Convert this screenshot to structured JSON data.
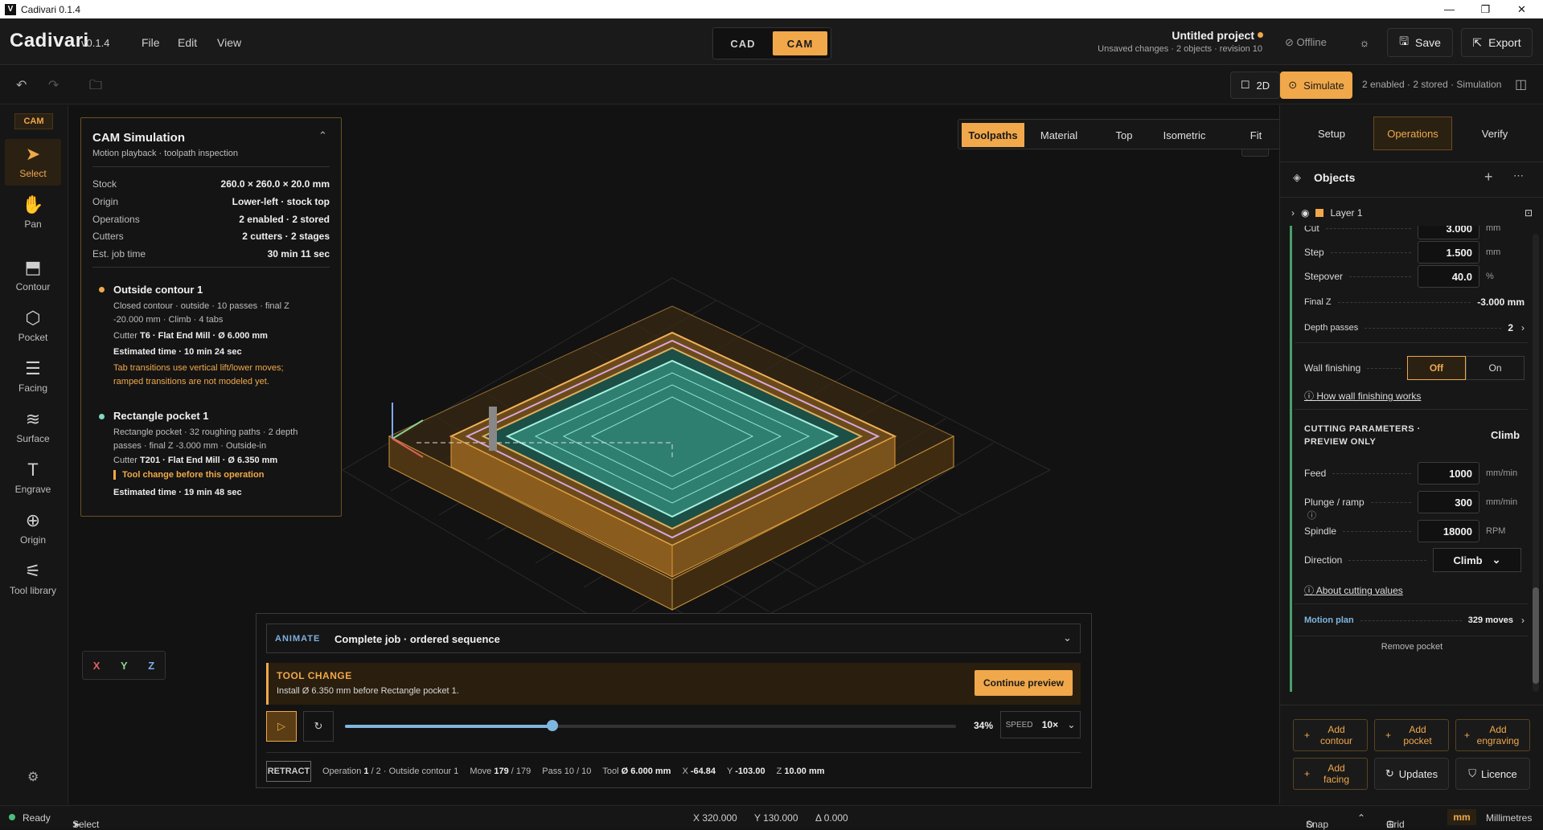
{
  "window": {
    "title": "Cadivari 0.1.4",
    "icon": "V"
  },
  "header": {
    "brand": "Cadivari",
    "version": "v0.1.4",
    "menu": [
      "File",
      "Edit",
      "View"
    ],
    "mode_cad": "CAD",
    "mode_cam": "CAM",
    "project_title": "Untitled project",
    "project_sub": "Unsaved changes · 2 objects · revision 10",
    "offline": "Offline",
    "save": "Save",
    "export": "Export"
  },
  "toolbar": {
    "toggle_2d": "2D",
    "simulate": "Simulate",
    "status": "2 enabled · 2 stored · Simulation"
  },
  "left_tools": {
    "badge": "CAM",
    "items": [
      "Select",
      "Pan",
      "Contour",
      "Pocket",
      "Facing",
      "Surface",
      "Engrave",
      "Origin",
      "Tool library"
    ]
  },
  "sim": {
    "title": "CAM Simulation",
    "subtitle": "Motion playback · toolpath inspection",
    "rows": [
      {
        "k": "Stock",
        "v": "260.0 × 260.0 × 20.0 mm"
      },
      {
        "k": "Origin",
        "v": "Lower-left · stock top"
      },
      {
        "k": "Operations",
        "v": "2 enabled · 2 stored"
      },
      {
        "k": "Cutters",
        "v": "2 cutters · 2 stages"
      },
      {
        "k": "Est. job time",
        "v": "30 min 11 sec"
      }
    ],
    "op1": {
      "name": "Outside contour 1",
      "desc1": "Closed contour · outside · 10 passes · final Z",
      "desc2": "-20.000 mm · Climb · 4 tabs",
      "cutter_label": "Cutter",
      "cutter": "T6 · Flat End Mill · Ø 6.000 mm",
      "time": "Estimated time · 10 min 24 sec",
      "warn1": "Tab transitions use vertical lift/lower moves;",
      "warn2": "ramped transitions are not modeled yet."
    },
    "op2": {
      "name": "Rectangle pocket 1",
      "desc1": "Rectangle pocket · 32 roughing paths · 2 depth",
      "desc2": "passes · final Z -3.000 mm · Outside-in",
      "cutter_label": "Cutter",
      "cutter": "T201 · Flat End Mill · Ø 6.350 mm",
      "toolchange": "Tool change before this operation",
      "time": "Estimated time · 19 min 48 sec"
    }
  },
  "view_tabs": [
    "Toolpaths",
    "Material",
    "Top",
    "Isometric",
    "Fit"
  ],
  "axes": [
    "X",
    "Y",
    "Z"
  ],
  "animate": {
    "badge": "ANIMATE",
    "title": "Complete job · ordered sequence",
    "tc_title": "TOOL CHANGE",
    "tc_desc": "Install Ø 6.350 mm before Rectangle pocket 1.",
    "continue": "Continue preview",
    "progress": 0.34,
    "progress_label": "34%",
    "speed_label": "SPEED",
    "speed": "10×",
    "retract": "RETRACT",
    "op_label": "Operation",
    "op_num": "1",
    "op_rest": "/ 2 · Outside contour 1",
    "move_label": "Move",
    "move_num": "179",
    "move_rest": "/ 179",
    "pass": "Pass 10 / 10",
    "tool_label": "Tool",
    "tool": "Ø 6.000 mm",
    "x_label": "X",
    "x": "-64.84",
    "y_label": "Y",
    "y": "-103.00",
    "z_label": "Z",
    "z": "10.00 mm"
  },
  "right": {
    "tabs": [
      "Setup",
      "Operations",
      "Verify"
    ],
    "objects": "Objects",
    "layer": "Layer 1",
    "cut_partial": "Cut",
    "cut_val": "3.000",
    "step_label": "Step",
    "step": "1.500",
    "step_unit": "mm",
    "stepover_label": "Stepover",
    "stepover": "40.0",
    "stepover_unit": "%",
    "finalz_label": "Final Z",
    "finalz": "-3.000 mm",
    "depth_label": "Depth passes",
    "depth": "2",
    "wall_label": "Wall finishing",
    "wall_off": "Off",
    "wall_on": "On",
    "wall_link": "How wall finishing works",
    "cp_title1": "CUTTING PARAMETERS ·",
    "cp_title2": "PREVIEW ONLY",
    "cp_dir": "Climb",
    "feed_label": "Feed",
    "feed": "1000",
    "feed_unit": "mm/min",
    "plunge_label": "Plunge / ramp",
    "plunge": "300",
    "plunge_unit": "mm/min",
    "spindle_label": "Spindle",
    "spindle": "18000",
    "spindle_unit": "RPM",
    "dir_label": "Direction",
    "dir": "Climb",
    "about_link": "About cutting values",
    "motion_label": "Motion plan",
    "motion": "329 moves",
    "remove": "Remove pocket",
    "add_contour": "Add contour",
    "add_pocket": "Add pocket",
    "add_engraving": "Add engraving",
    "add_facing": "Add facing",
    "updates": "Updates",
    "licence": "Licence"
  },
  "status": {
    "ready": "Ready",
    "select": "Select",
    "x": "X  320.000",
    "y": "Y  130.000",
    "d": "Δ  0.000",
    "snap": "Snap",
    "grid": "Grid",
    "mm": "mm",
    "units": "Millimetres"
  },
  "colors": {
    "accent": "#f0a84a",
    "pocket": "#7fd8c4"
  }
}
